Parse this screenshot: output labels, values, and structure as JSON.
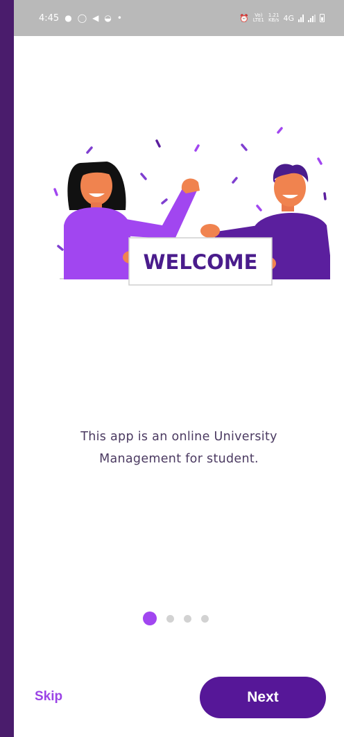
{
  "status_bar": {
    "time": "4:45",
    "notification_icons": [
      "chat-icon",
      "whatsapp-icon",
      "telegram-icon",
      "app-icon",
      "dot-icon"
    ],
    "network_vo": "Vo)",
    "network_lte": "LTE1",
    "speed_value": "1.21",
    "speed_unit": "KB/s",
    "network_type": "4G"
  },
  "illustration": {
    "sign_text": "WELCOME"
  },
  "description": {
    "line1": "This app is an online University",
    "line2": "Management for student."
  },
  "pager": {
    "total": 4,
    "active_index": 0
  },
  "actions": {
    "skip_label": "Skip",
    "next_label": "Next"
  },
  "colors": {
    "frame": "#4a1c6c",
    "primary": "#561798",
    "accent": "#a146f0",
    "status_bar": "#b9b9b9"
  }
}
